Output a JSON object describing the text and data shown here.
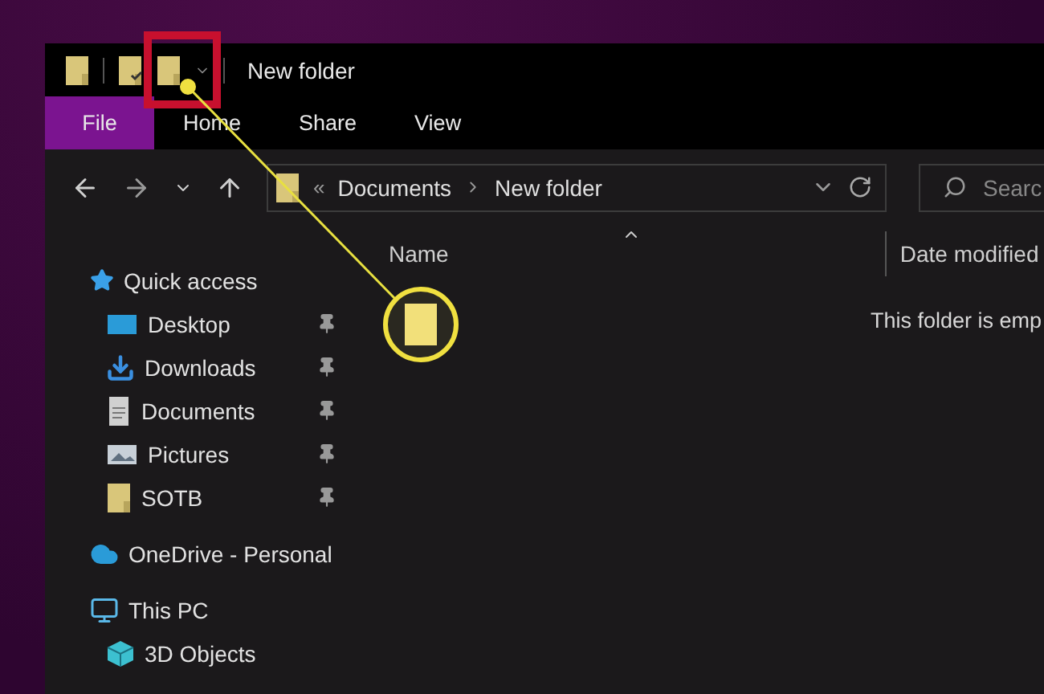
{
  "window": {
    "title": "New folder"
  },
  "ribbon_tabs": [
    {
      "label": "File",
      "selected": true
    },
    {
      "label": "Home",
      "selected": false
    },
    {
      "label": "Share",
      "selected": false
    },
    {
      "label": "View",
      "selected": false
    }
  ],
  "address_bar": {
    "overflow": "«",
    "segments": [
      "Documents",
      "New folder"
    ]
  },
  "search": {
    "placeholder": "Searc"
  },
  "columns": [
    "Name",
    "Date modified"
  ],
  "empty_message": "This folder is emp",
  "sidebar": [
    {
      "label": "Quick access",
      "kind": "star",
      "children": [
        {
          "label": "Desktop",
          "kind": "desktop",
          "pinned": true
        },
        {
          "label": "Downloads",
          "kind": "downloads",
          "pinned": true
        },
        {
          "label": "Documents",
          "kind": "document",
          "pinned": true
        },
        {
          "label": "Pictures",
          "kind": "pictures",
          "pinned": true
        },
        {
          "label": "SOTB",
          "kind": "folder",
          "pinned": true
        }
      ]
    },
    {
      "label": "OneDrive - Personal",
      "kind": "cloud"
    },
    {
      "label": "This PC",
      "kind": "pc",
      "children": [
        {
          "label": "3D Objects",
          "kind": "cube"
        }
      ]
    }
  ]
}
